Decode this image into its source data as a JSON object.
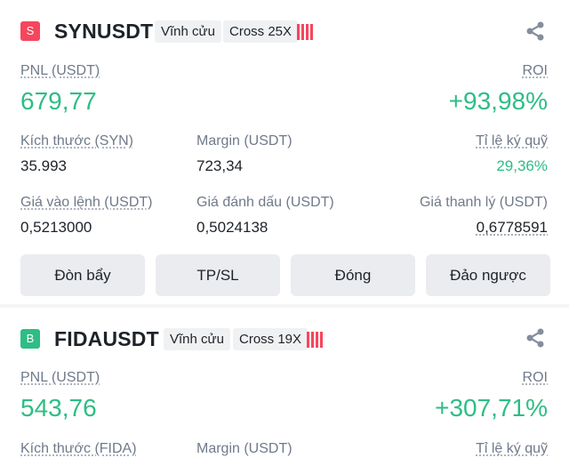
{
  "positions": [
    {
      "side_letter": "S",
      "side_color": "#f6465d",
      "symbol": "SYNUSDT",
      "type_tag": "Vĩnh cửu",
      "margin_tag": "Cross 25X",
      "pnl_label": "PNL (USDT)",
      "pnl": "679,77",
      "roi_label": "ROI",
      "roi": "+93,98%",
      "size_label": "Kích thước (SYN)",
      "size": "35.993",
      "margin_label": "Margin (USDT)",
      "margin": "723,34",
      "margin_ratio_label": "Tỉ lệ ký quỹ",
      "margin_ratio": "29,36%",
      "entry_label": "Giá vào lệnh (USDT)",
      "entry": "0,5213000",
      "mark_label": "Giá đánh dấu (USDT)",
      "mark": "0,5024138",
      "liq_label": "Giá thanh lý (USDT)",
      "liq": "0,6778591",
      "buttons": [
        "Đòn bẩy",
        "TP/SL",
        "Đóng",
        "Đảo ngược"
      ]
    },
    {
      "side_letter": "B",
      "side_color": "#2ebd85",
      "symbol": "FIDAUSDT",
      "type_tag": "Vĩnh cửu",
      "margin_tag": "Cross 19X",
      "pnl_label": "PNL (USDT)",
      "pnl": "543,76",
      "roi_label": "ROI",
      "roi": "+307,71%",
      "size_label": "Kích thước (FIDA)",
      "margin_label": "Margin (USDT)",
      "margin_ratio_label": "Tỉ lệ ký quỹ"
    }
  ],
  "icons": {
    "share": "share-icon",
    "risk": "risk-bars-icon"
  },
  "colors": {
    "profit": "#2ebd85",
    "risk": "#f6465d"
  }
}
